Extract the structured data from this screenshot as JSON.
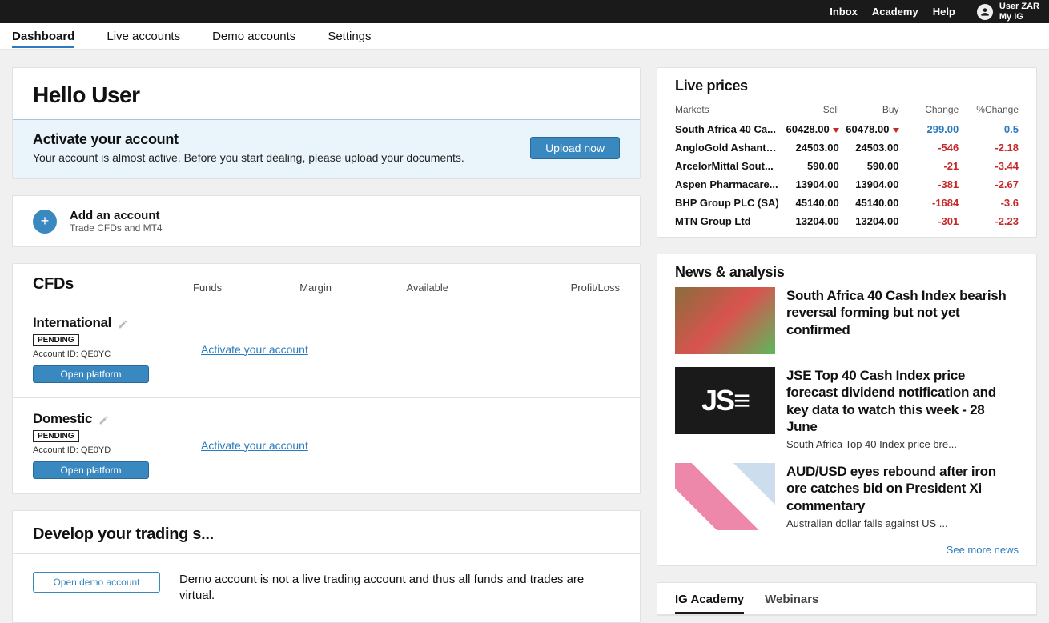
{
  "topbar": {
    "links": [
      "Inbox",
      "Academy",
      "Help"
    ],
    "username": "User ZAR",
    "myig": "My IG"
  },
  "nav": {
    "tabs": [
      "Dashboard",
      "Live accounts",
      "Demo accounts",
      "Settings"
    ],
    "active": 0
  },
  "hello": {
    "greeting": "Hello User",
    "activate_title": "Activate your account",
    "activate_desc": "Your account is almost active. Before you start dealing, please upload your documents.",
    "upload_btn": "Upload now"
  },
  "add_account": {
    "title": "Add an account",
    "subtitle": "Trade CFDs and MT4"
  },
  "cfds": {
    "title": "CFDs",
    "columns": [
      "Funds",
      "Margin",
      "Available",
      "Profit/Loss"
    ],
    "accounts": [
      {
        "name": "International",
        "status": "PENDING",
        "id_label": "Account ID: QE0YC",
        "open_btn": "Open platform",
        "activate": "Activate your account"
      },
      {
        "name": "Domestic",
        "status": "PENDING",
        "id_label": "Account ID: QE0YD",
        "open_btn": "Open platform",
        "activate": "Activate your account"
      }
    ]
  },
  "develop": {
    "title": "Develop your trading s...",
    "demo_btn": "Open demo account",
    "desc": "Demo account is not a live trading account and thus all funds and trades are virtual."
  },
  "live_prices": {
    "title": "Live prices",
    "headers": {
      "markets": "Markets",
      "sell": "Sell",
      "buy": "Buy",
      "change": "Change",
      "pct": "%Change"
    },
    "rows": [
      {
        "market": "South Africa 40 Ca...",
        "sell": "60428.00",
        "buy": "60478.00",
        "tri": true,
        "change": "299.00",
        "pct": "0.5",
        "color": "blue"
      },
      {
        "market": "AngloGold Ashanti ...",
        "sell": "24503.00",
        "buy": "24503.00",
        "change": "-546",
        "pct": "-2.18",
        "color": "neg"
      },
      {
        "market": "ArcelorMittal Sout...",
        "sell": "590.00",
        "buy": "590.00",
        "change": "-21",
        "pct": "-3.44",
        "color": "neg"
      },
      {
        "market": "Aspen Pharmacare...",
        "sell": "13904.00",
        "buy": "13904.00",
        "change": "-381",
        "pct": "-2.67",
        "color": "neg"
      },
      {
        "market": "BHP Group PLC (SA)",
        "sell": "45140.00",
        "buy": "45140.00",
        "change": "-1684",
        "pct": "-3.6",
        "color": "neg"
      },
      {
        "market": "MTN Group Ltd",
        "sell": "13204.00",
        "buy": "13204.00",
        "change": "-301",
        "pct": "-2.23",
        "color": "neg"
      }
    ]
  },
  "news": {
    "title": "News & analysis",
    "items": [
      {
        "headline": "South Africa 40 Cash Index bearish reversal forming but not yet confirmed",
        "summary": "",
        "thumb": "money"
      },
      {
        "headline": "JSE Top 40 Cash Index price forecast dividend notification and key data to watch this week - 28 June",
        "summary": "South Africa Top 40 Index price bre...",
        "thumb": "jse"
      },
      {
        "headline": "AUD/USD eyes rebound after iron ore catches bid on President Xi commentary",
        "summary": "Australian dollar falls against US ...",
        "thumb": "curr"
      }
    ],
    "see_more": "See more news"
  },
  "bottom_tabs": {
    "tabs": [
      "IG Academy",
      "Webinars"
    ],
    "active": 0
  }
}
